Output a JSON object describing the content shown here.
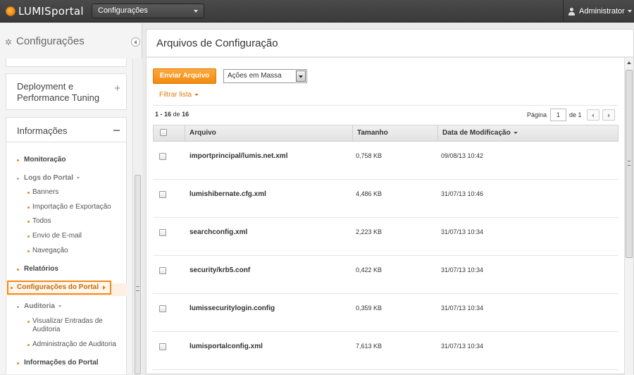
{
  "topbar": {
    "logo_text": "LUMISportal",
    "context_select": "Configurações",
    "user": "Administrator"
  },
  "sidebar": {
    "title": "Configurações",
    "deploy_panel": "Deployment e Performance Tuning",
    "info_panel": "Informações",
    "items": [
      {
        "label": "Monitoração"
      },
      {
        "label": "Logs do Portal"
      },
      {
        "label": "Banners"
      },
      {
        "label": "Importação e Exportação"
      },
      {
        "label": "Todos"
      },
      {
        "label": "Envio de E-mail"
      },
      {
        "label": "Navegação"
      },
      {
        "label": "Relatórios"
      },
      {
        "label": "Configurações do Portal"
      },
      {
        "label": "Auditoria"
      },
      {
        "label": "Visualizar Entradas de Auditoria"
      },
      {
        "label": "Administração de Auditoria"
      },
      {
        "label": "Informações do Portal"
      }
    ]
  },
  "content": {
    "title": "Arquivos de Configuração",
    "upload_button": "Enviar Arquivo",
    "bulk_actions": "Ações em Massa",
    "filter": "Filtrar lista",
    "count": {
      "range": "1 - 16",
      "sep": "de",
      "total": "16"
    },
    "pager": {
      "label": "Página",
      "page": "1",
      "of": "de 1"
    },
    "columns": [
      "Arquivo",
      "Tamanho",
      "Data de Modificação"
    ],
    "rows": [
      {
        "file": "importprincipal/lumis.net.xml",
        "size": "0,758 KB",
        "date": "09/08/13 10:42"
      },
      {
        "file": "lumishibernate.cfg.xml",
        "size": "4,486 KB",
        "date": "31/07/13 10:46"
      },
      {
        "file": "searchconfig.xml",
        "size": "2,223 KB",
        "date": "31/07/13 10:34"
      },
      {
        "file": "security/krb5.conf",
        "size": "0,422 KB",
        "date": "31/07/13 10:34"
      },
      {
        "file": "lumissecuritylogin.config",
        "size": "0,359 KB",
        "date": "31/07/13 10:34"
      },
      {
        "file": "lumisportalconfig.xml",
        "size": "7,613 KB",
        "date": "31/07/13 10:34"
      }
    ]
  },
  "colors": {
    "accent": "#f28a1a",
    "topbar": "#3f3f3f"
  },
  "icons": [
    "logo-icon",
    "gear-icon",
    "user-icon",
    "collapse-icon"
  ]
}
